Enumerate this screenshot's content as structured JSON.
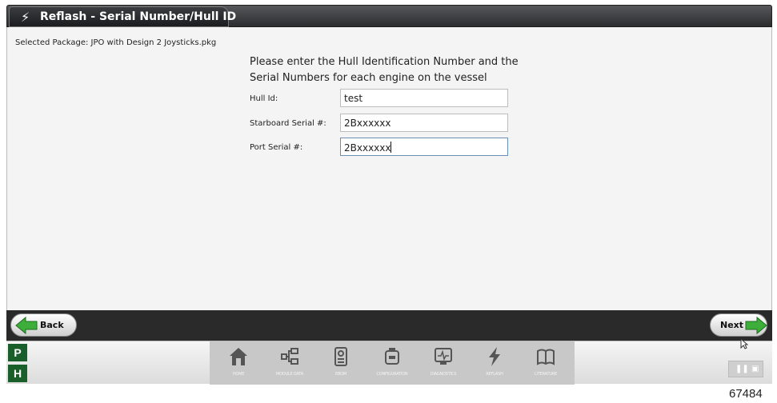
{
  "window": {
    "title": "Reflash - Serial Number/Hull ID",
    "title_icon": "lightning-bolt-icon"
  },
  "content": {
    "selected_package": "Selected Package: JPO with Design 2 Joysticks.pkg",
    "instructions_line1": "Please enter the Hull Identification Number and the",
    "instructions_line2": "Serial Numbers for each engine on the vessel",
    "fields": [
      {
        "label": "Hull Id:",
        "value": "test"
      },
      {
        "label": "Starboard Serial #:",
        "value": "2Bxxxxxx"
      },
      {
        "label": "Port Serial #:",
        "value": "2Bxxxxxx"
      }
    ]
  },
  "navbar": {
    "back_label": "Back",
    "next_label": "Next"
  },
  "taskbar": {
    "p_label": "P",
    "h_label": "H",
    "modules": [
      {
        "label": "HOME",
        "icon": "home-icon"
      },
      {
        "label": "MODULE DATA",
        "icon": "module-data-icon"
      },
      {
        "label": "EBOM",
        "icon": "ebom-icon"
      },
      {
        "label": "CONFIGURATION",
        "icon": "configuration-icon"
      },
      {
        "label": "DIAGNOSTICS",
        "icon": "diagnostics-icon"
      },
      {
        "label": "REFLASH",
        "icon": "reflash-icon"
      },
      {
        "label": "LITERATURE",
        "icon": "literature-icon"
      }
    ]
  },
  "figure_number": "67484",
  "colors": {
    "title_bar": "#2c2d2f",
    "nav_bar": "#2a2a2a",
    "ph_green": "#1a5e2a",
    "arrow_green": "#3dae3a"
  }
}
